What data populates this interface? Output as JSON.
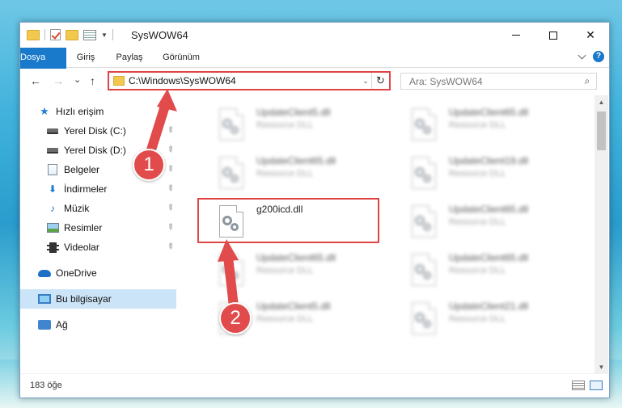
{
  "window": {
    "title": "SysWOW64",
    "minimize_label": "",
    "close_label": "✕"
  },
  "ribbon": {
    "tabs": [
      "Dosya",
      "Giriş",
      "Paylaş",
      "Görünüm"
    ]
  },
  "nav": {
    "back": "←",
    "forward": "→",
    "recent": "⌄",
    "up": "↑",
    "address": "C:\\Windows\\SysWOW64",
    "refresh": "↻",
    "search_placeholder": "Ara: SysWOW64"
  },
  "sidebar": {
    "items": [
      {
        "label": "Hızlı erişim",
        "icon": "star-icon",
        "pinned": false
      },
      {
        "label": "Yerel Disk (C:)",
        "icon": "disk-icon",
        "pinned": true
      },
      {
        "label": "Yerel Disk (D:)",
        "icon": "disk-icon",
        "pinned": true
      },
      {
        "label": "Belgeler",
        "icon": "document-icon",
        "pinned": true
      },
      {
        "label": "İndirmeler",
        "icon": "download-icon",
        "pinned": true
      },
      {
        "label": "Müzik",
        "icon": "music-icon",
        "pinned": true
      },
      {
        "label": "Resimler",
        "icon": "pictures-icon",
        "pinned": true
      },
      {
        "label": "Videolar",
        "icon": "video-icon",
        "pinned": true
      },
      {
        "label": "OneDrive",
        "icon": "cloud-icon",
        "pinned": false
      },
      {
        "label": "Bu bilgisayar",
        "icon": "computer-icon",
        "pinned": false,
        "selected": true
      },
      {
        "label": "Ağ",
        "icon": "network-icon",
        "pinned": false
      }
    ]
  },
  "files": [
    {
      "name": "UpdateClient5.dll",
      "type": "Resource DLL",
      "blurred": true
    },
    {
      "name": "UpdateClient65.dll",
      "type": "Resource DLL",
      "blurred": true
    },
    {
      "name": "UpdateClient65.dll",
      "type": "Resource DLL",
      "blurred": true
    },
    {
      "name": "UpdateClient19.dll",
      "type": "Resource DLL",
      "blurred": true
    },
    {
      "name": "g200icd.dll",
      "type": "",
      "blurred": false
    },
    {
      "name": "UpdateClient65.dll",
      "type": "Resource DLL",
      "blurred": true
    },
    {
      "name": "UpdateClient65.dll",
      "type": "Resource DLL",
      "blurred": true
    },
    {
      "name": "UpdateClient65.dll",
      "type": "Resource DLL",
      "blurred": true
    },
    {
      "name": "UpdateClient5.dll",
      "type": "Resource DLL",
      "blurred": true
    },
    {
      "name": "UpdateClient21.dll",
      "type": "Resource DLL",
      "blurred": true
    }
  ],
  "status": {
    "count": "183 öğe"
  },
  "callouts": [
    "1",
    "2"
  ],
  "colors": {
    "accent": "#1979ca",
    "highlight_red": "#e04545",
    "selection": "#cce4f7"
  }
}
